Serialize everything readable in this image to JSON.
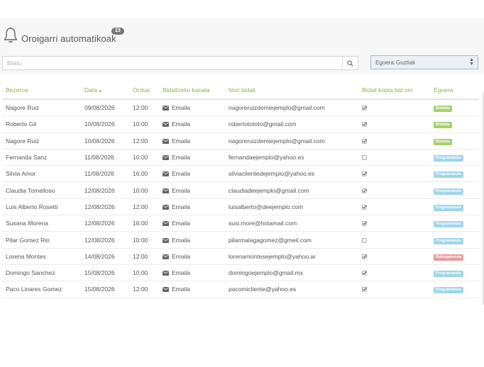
{
  "header": {
    "title": "Oroigarri automatikoak",
    "count": "23"
  },
  "search": {
    "placeholder": "Bilatu",
    "value": ""
  },
  "status_filter": {
    "label": "Egoera:",
    "value": "Guztiak"
  },
  "table": {
    "columns": {
      "client": "Bezeroa",
      "date": "Data",
      "time": "Ordua",
      "channel": "Bidaltzeko kanala",
      "to": "Nori bidali",
      "copy": "Bidali kopia bat niri",
      "status": "Egoera"
    },
    "rows": [
      {
        "client": "Nagore Ruiz",
        "date": "09/08/2026",
        "time": "12:00",
        "channel": "Emaila",
        "to": "nagoreruizdemiejemplo@gmail.com",
        "copy": true,
        "status": "Bidalita",
        "status_color": "#a3d16b"
      },
      {
        "client": "Roberto Gil",
        "date": "10/08/2026",
        "time": "10:00",
        "channel": "Emaila",
        "to": "robertotototo@gmail.com",
        "copy": true,
        "status": "Bidalita",
        "status_color": "#a3d16b"
      },
      {
        "client": "Nagore Ruiz",
        "date": "10/08/2026",
        "time": "12:00",
        "channel": "Emaila",
        "to": "nagoreruizdemiejemplo@gmail.com",
        "copy": true,
        "status": "Bidalita",
        "status_color": "#a3d16b"
      },
      {
        "client": "Fernanda Sanz",
        "date": "11/08/2026",
        "time": "10:00",
        "channel": "Emaila",
        "to": "fernandaejemplo@yahoo.es",
        "copy": false,
        "status": "Programatuta",
        "status_color": "#9ed6ea"
      },
      {
        "client": "Silvia Amor",
        "date": "11/08/2026",
        "time": "16:00",
        "channel": "Emaila",
        "to": "silviaclientedejemplo@yahoo.es",
        "copy": true,
        "status": "Programatuta",
        "status_color": "#9ed6ea"
      },
      {
        "client": "Claudia Tomelloso",
        "date": "12/08/2026",
        "time": "10:00",
        "channel": "Emaila",
        "to": "claudiadeejemplo@gmail.com",
        "copy": true,
        "status": "Programatuta",
        "status_color": "#9ed6ea"
      },
      {
        "client": "Luis Alberto Rosetti",
        "date": "12/08/2026",
        "time": "12:00",
        "channel": "Emaila",
        "to": "luisalberto@deejemplo.com",
        "copy": true,
        "status": "Programatuta",
        "status_color": "#9ed6ea"
      },
      {
        "client": "Susana Morena",
        "date": "12/08/2026",
        "time": "16:00",
        "channel": "Emaila",
        "to": "susi.more@hotamail.com",
        "copy": true,
        "status": "Programatuta",
        "status_color": "#9ed6ea"
      },
      {
        "client": "Pilar Gomez Rio",
        "date": "12/08/2026",
        "time": "10:00",
        "channel": "Emaila",
        "to": "pilarmalagagomez@gmeil.com",
        "copy": false,
        "status": "Programatuta",
        "status_color": "#9ed6ea"
      },
      {
        "client": "Lorena Montes",
        "date": "14/08/2026",
        "time": "12:00",
        "channel": "Emaila",
        "to": "lorenamontesejemplo@yahoo.ar",
        "copy": true,
        "status": "Baliogabetuta",
        "status_color": "#e79a9a"
      },
      {
        "client": "Domingo Sanchez",
        "date": "15/08/2026",
        "time": "10:00",
        "channel": "Emaila",
        "to": "domingoejemplo@gmail.mx",
        "copy": true,
        "status": "Programatuta",
        "status_color": "#9ed6ea"
      },
      {
        "client": "Paco Linares Gomez",
        "date": "15/08/2026",
        "time": "12:00",
        "channel": "Emaila",
        "to": "pacomicliente@yahoo.es",
        "copy": true,
        "status": "Programatuta",
        "status_color": "#9ed6ea"
      }
    ]
  },
  "icons": {
    "bell": "bell-icon",
    "search": "search-icon",
    "mail": "envelope-icon",
    "checked": "checkbox-checked-icon",
    "unchecked": "checkbox-unchecked-icon",
    "sort": "sort-asc-icon",
    "select_arrow": "select-arrows-icon"
  },
  "colors": {
    "header_text": "#8cb255",
    "sent": "#a3d16b",
    "scheduled": "#9ed6ea",
    "cancelled": "#e79a9a"
  }
}
